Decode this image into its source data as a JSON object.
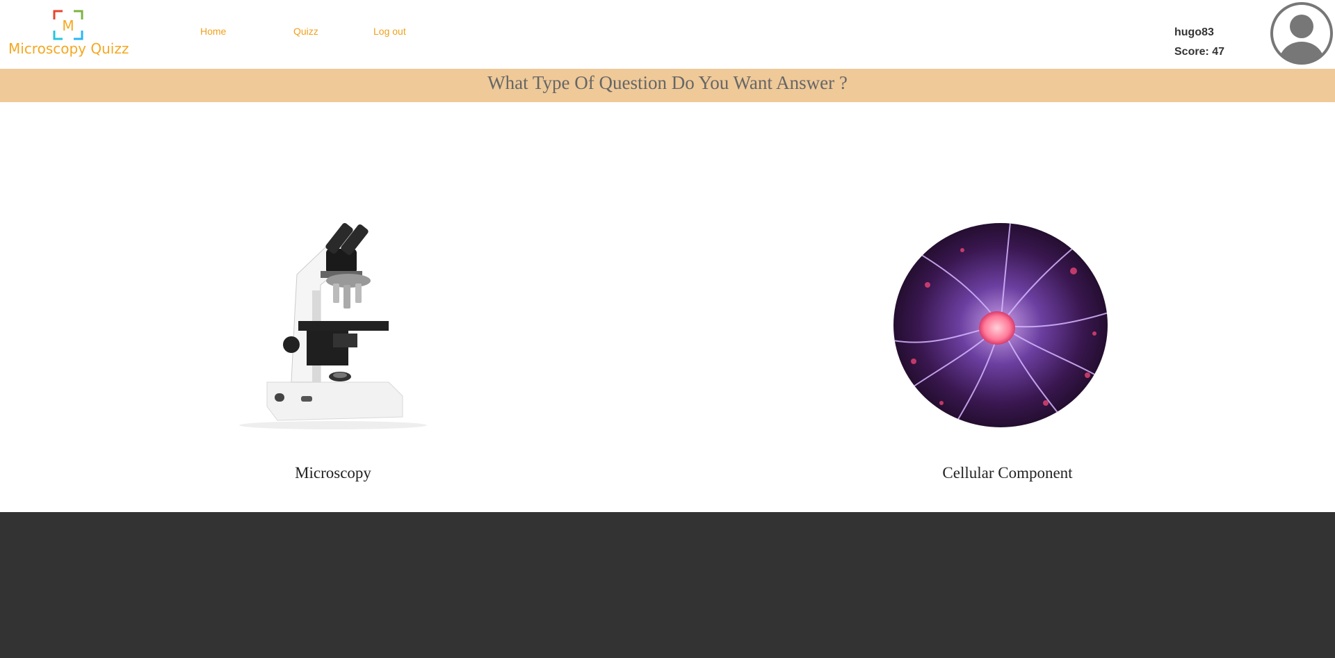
{
  "header": {
    "logo_letter": "M",
    "logo_text": "Microscopy Quizz",
    "nav": [
      {
        "label": "Home"
      },
      {
        "label": "Quizz"
      },
      {
        "label": "Log out"
      }
    ],
    "username": "hugo83",
    "score": "Score: 47"
  },
  "banner": {
    "title": "What Type Of Question Do You Want Answer ?"
  },
  "choices": [
    {
      "label": "Microscopy",
      "icon": "microscope-image"
    },
    {
      "label": "Cellular Component",
      "icon": "neuron-cell-image"
    }
  ],
  "colors": {
    "accent": "#f0a01c",
    "banner": "#efc998",
    "footer": "#333333"
  }
}
